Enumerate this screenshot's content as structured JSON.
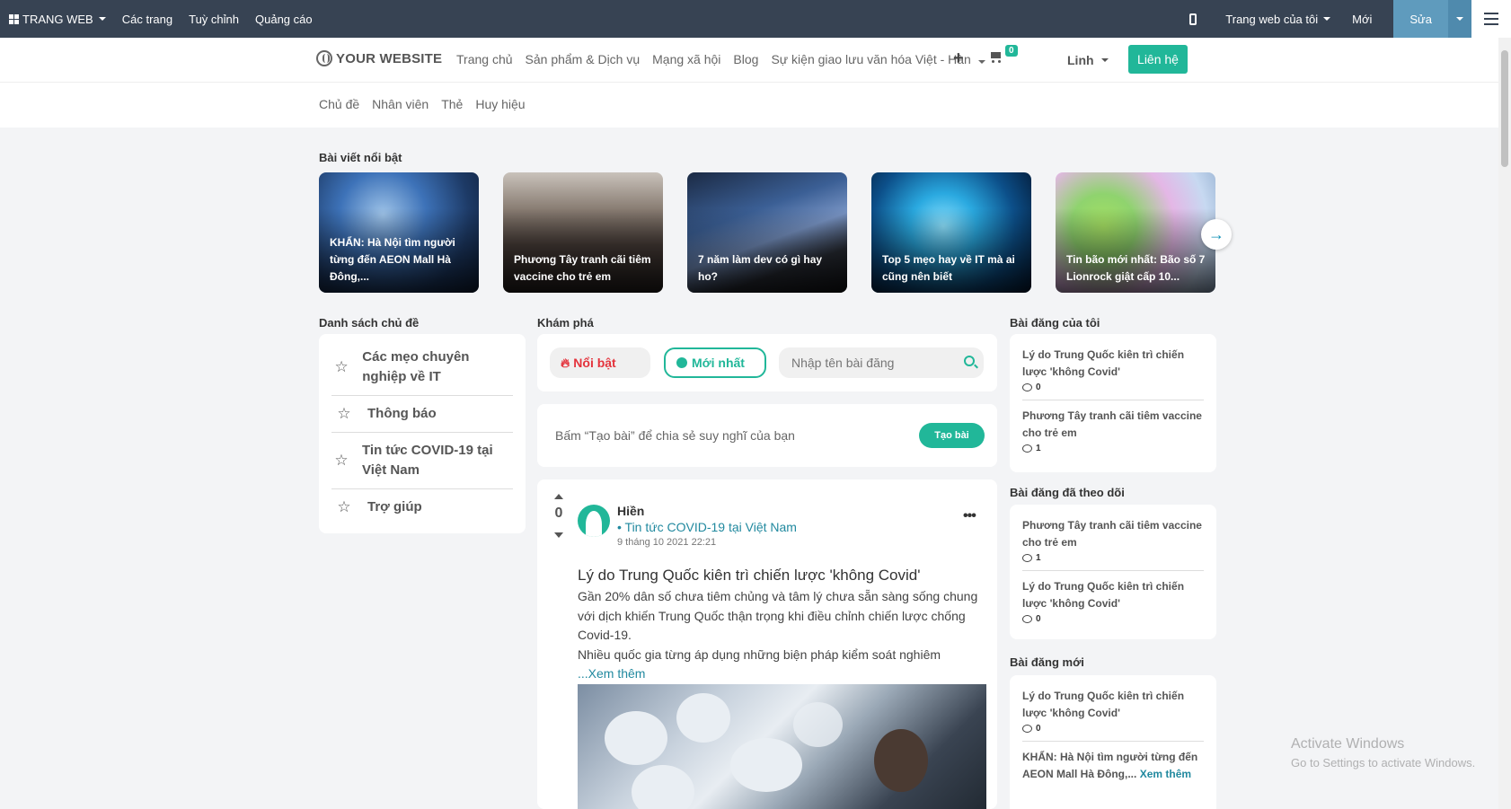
{
  "adminbar": {
    "app": "TRANG WEB",
    "pages": "Các trang",
    "customize": "Tuỳ chỉnh",
    "ads": "Quảng cáo",
    "my_site": "Trang web của tôi",
    "new": "Mới",
    "edit": "Sửa"
  },
  "header": {
    "logo": "YOUR WEBSITE",
    "nav": [
      "Trang chủ",
      "Sản phẩm & Dịch vụ",
      "Mạng xã hội",
      "Blog",
      "Sự kiện giao lưu văn hóa Việt - Hàn"
    ],
    "cart_count": "0",
    "user": "Linh",
    "contact": "Liên hệ"
  },
  "subnav": [
    "Chủ đề",
    "Nhân viên",
    "Thẻ",
    "Huy hiệu"
  ],
  "featured": {
    "title": "Bài viết nổi bật",
    "cards": [
      {
        "text": "KHẨN: Hà Nội tìm người từng đến AEON Mall Hà Đông,..."
      },
      {
        "text": "Phương Tây tranh cãi tiêm vaccine cho trẻ em"
      },
      {
        "text": "7 năm làm dev có gì hay ho?"
      },
      {
        "text": "Top 5 mẹo hay về IT mà ai cũng nên biết"
      },
      {
        "text": "Tin bão mới nhất: Bão số 7 Lionrock giật cấp 10..."
      }
    ]
  },
  "topics": {
    "title": "Danh sách chủ đề",
    "items": [
      "Các mẹo chuyên nghiệp về IT",
      "Thông báo",
      "Tin tức COVID-19 tại Việt Nam",
      "Trợ giúp"
    ]
  },
  "explore": {
    "title": "Khám phá",
    "hot": "Nổi bật",
    "newest": "Mới nhất",
    "search_placeholder": "Nhập tên bài đăng"
  },
  "create": {
    "placeholder": "Bấm “Tạo bài” để chia sẻ suy nghĩ của bạn",
    "button": "Tạo bài"
  },
  "post": {
    "votes": "0",
    "author": "Hiền",
    "topic": "• Tin tức COVID-19 tại Việt Nam",
    "date": "9 tháng 10 2021 22:21",
    "title": "Lý do Trung Quốc kiên trì chiến lược 'không Covid'",
    "body1": "Gần 20% dân số chưa tiêm chủng và tâm lý chưa sẵn sàng sống chung với dịch khiến Trung Quốc thận trọng khi điều chỉnh chiến lược chống Covid-19.",
    "body2": "Nhiều quốc gia từng áp dụng những biện pháp kiểm soát nghiêm",
    "readmore": "...Xem thêm"
  },
  "my_posts": {
    "title": "Bài đăng của tôi",
    "items": [
      {
        "title": "Lý do Trung Quốc kiên trì chiến lược 'không Covid'",
        "count": "0"
      },
      {
        "title": "Phương Tây tranh cãi tiêm vaccine cho trẻ em",
        "count": "1"
      }
    ]
  },
  "followed_posts": {
    "title": "Bài đăng đã theo dõi",
    "items": [
      {
        "title": "Phương Tây tranh cãi tiêm vaccine cho trẻ em",
        "count": "1"
      },
      {
        "title": "Lý do Trung Quốc kiên trì chiến lược 'không Covid'",
        "count": "0"
      }
    ]
  },
  "new_posts": {
    "title": "Bài đăng mới",
    "items": [
      {
        "title": "Lý do Trung Quốc kiên trì chiến lược 'không Covid'",
        "count": "0"
      },
      {
        "title": "KHẨN: Hà Nội tìm người từng đến AEON Mall Hà Đông,...",
        "more": "Xem thêm"
      }
    ]
  },
  "watermark": {
    "line1": "Activate Windows",
    "line2": "Go to Settings to activate Windows."
  },
  "colors": {
    "adminbar": "#374353",
    "accent": "#21b799",
    "link": "#21899f",
    "hot": "#e4333c"
  }
}
